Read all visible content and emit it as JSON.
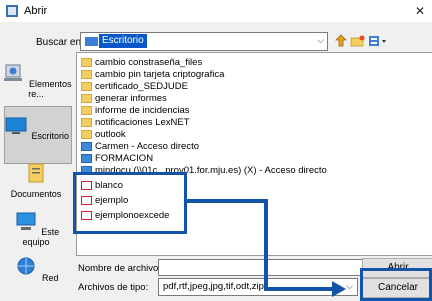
{
  "window": {
    "title": "Abrir",
    "close_glyph": "✕"
  },
  "lookin": {
    "label": "Buscar en:",
    "value": "Escritorio"
  },
  "toolbar": {
    "up_icon": "up-folder-icon",
    "new_folder_icon": "new-folder-icon",
    "view_icon": "view-menu-icon"
  },
  "places": [
    {
      "label": "Elementos re..."
    },
    {
      "label": "Escritorio"
    },
    {
      "label": "Documentos"
    },
    {
      "label": "Este equipo"
    },
    {
      "label": "Red"
    }
  ],
  "files": [
    {
      "name": "cambio constraseña_files",
      "type": "folder"
    },
    {
      "name": "cambio pin tarjeta criptografica",
      "type": "folder"
    },
    {
      "name": "certificado_SEDJUDE",
      "type": "folder"
    },
    {
      "name": "generar informes",
      "type": "folder"
    },
    {
      "name": "informe de incidencias",
      "type": "folder"
    },
    {
      "name": "notificaciones LexNET",
      "type": "folder"
    },
    {
      "name": "outlook",
      "type": "folder"
    },
    {
      "name": "Carmen - Acceso directo",
      "type": "shortcut"
    },
    {
      "name": "FORMACION",
      "type": "shortcut"
    },
    {
      "name": "mindocu (\\\\01c...prov01.for.mju.es) (X) - Acceso directo",
      "type": "shortcut"
    },
    {
      "name": "blanco",
      "type": "pdf"
    },
    {
      "name": "ejemplo",
      "type": "pdf"
    },
    {
      "name": "ejemplonoexcede",
      "type": "pdf"
    }
  ],
  "filename": {
    "label": "Nombre de archivo:",
    "value": ""
  },
  "filetype": {
    "label": "Archivos de tipo:",
    "value": "pdf,rtf,jpeg,jpg,tif,odt,zip"
  },
  "buttons": {
    "open": "Abrir",
    "cancel": "Cancelar"
  },
  "colors": {
    "annotation": "#1354a8",
    "selection": "#0a58c8"
  }
}
